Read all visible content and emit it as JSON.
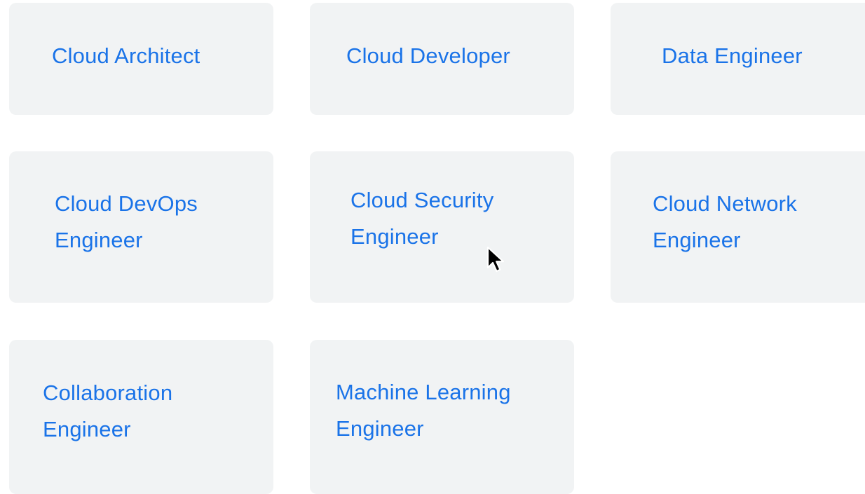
{
  "role_cards": [
    {
      "label": "Cloud Architect"
    },
    {
      "label": "Cloud Developer"
    },
    {
      "label": "Data Engineer"
    },
    {
      "label": "Cloud DevOps Engineer",
      "line1": "Cloud DevOps",
      "line2": "Engineer"
    },
    {
      "label": "Cloud Security Engineer",
      "line1": "Cloud Security",
      "line2": "Engineer"
    },
    {
      "label": "Cloud Network Engineer",
      "line1": "Cloud Network",
      "line2": "Engineer"
    },
    {
      "label": "Collaboration Engineer",
      "line1": "Collaboration",
      "line2": "Engineer"
    },
    {
      "label": "Machine Learning Engineer",
      "line1": "Machine Learning",
      "line2": "Engineer"
    }
  ],
  "colors": {
    "card_background": "#f1f3f4",
    "link_text": "#1a73e8",
    "page_background": "#ffffff"
  },
  "cursor": {
    "icon": "mouse-pointer-icon"
  }
}
